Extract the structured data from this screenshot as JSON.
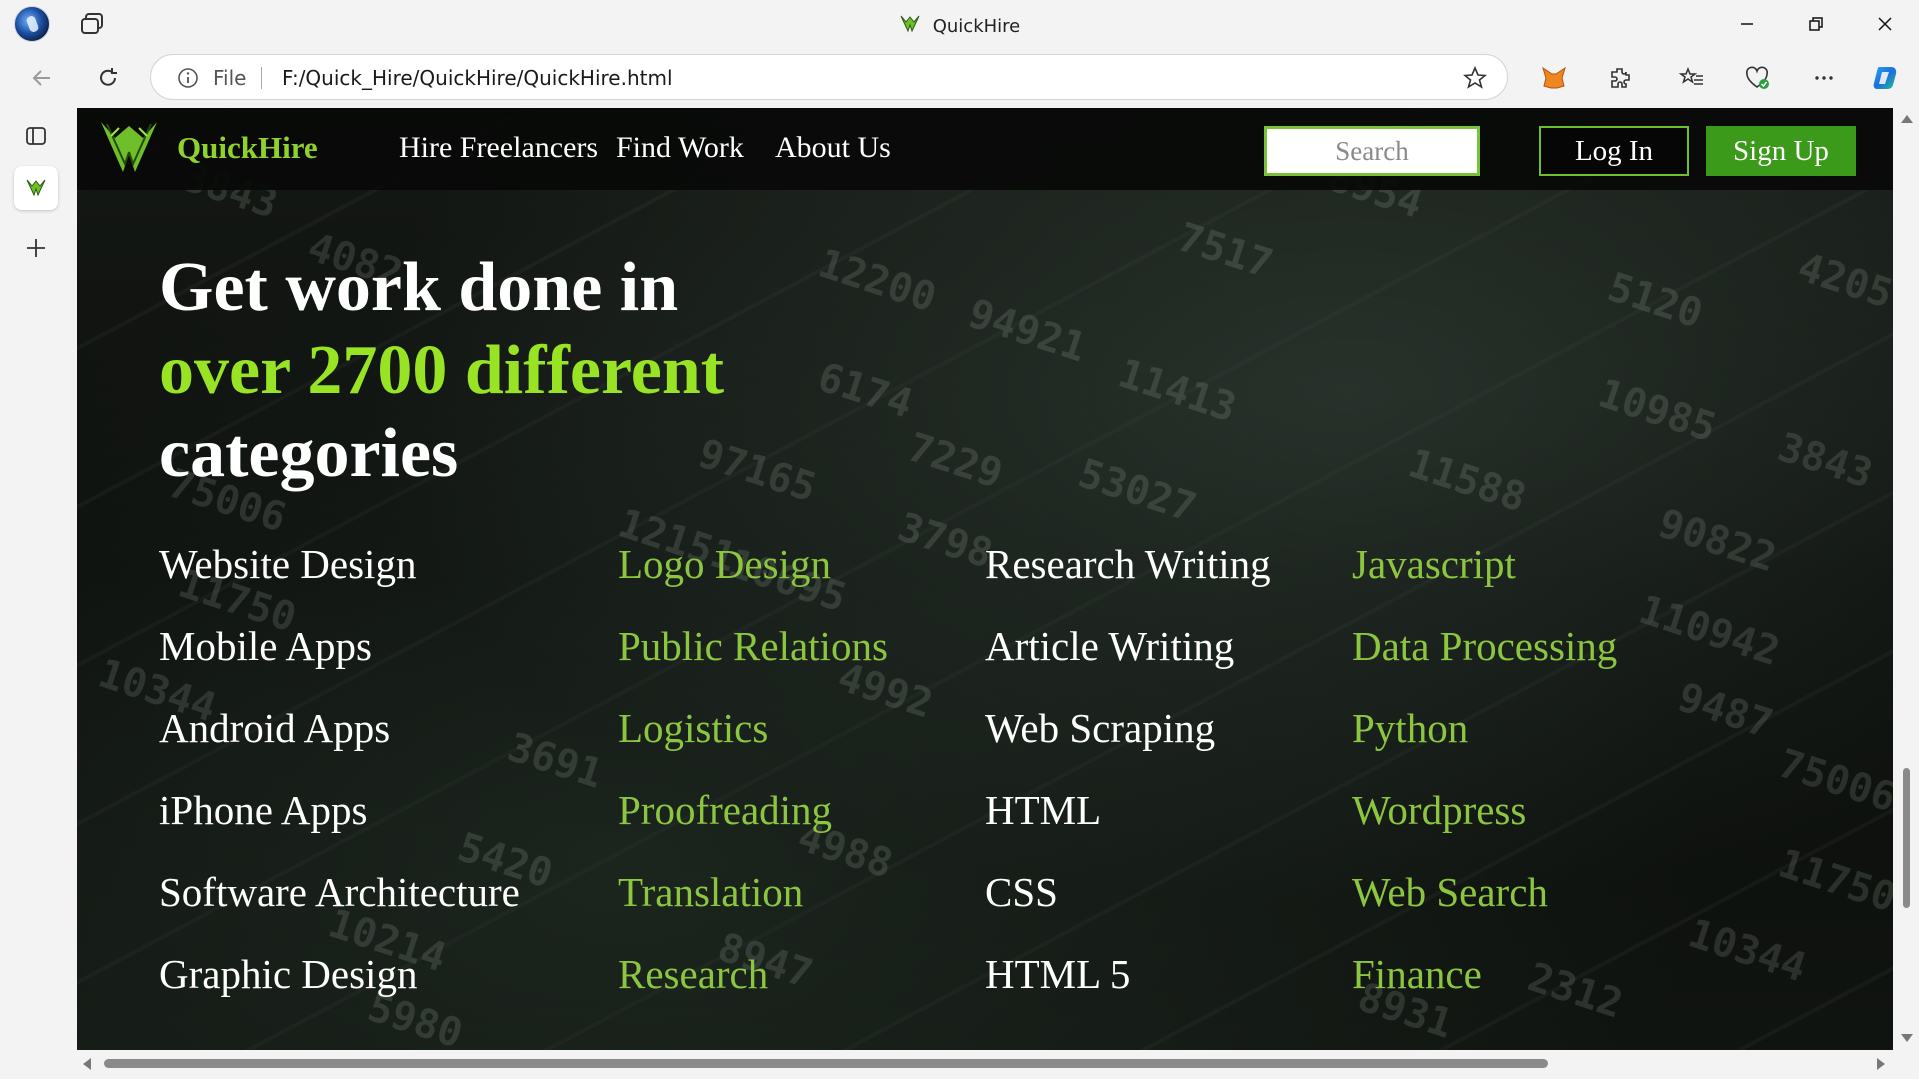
{
  "browser": {
    "window_title": "QuickHire",
    "address_scheme": "File",
    "address_url": "F:/Quick_Hire/QuickHire/QuickHire.html"
  },
  "site": {
    "brand": "QuickHire",
    "nav": [
      "Hire Freelancers",
      "Find Work",
      "About Us"
    ],
    "search_placeholder": "Search",
    "login_label": "Log In",
    "signup_label": "Sign Up",
    "accent_color": "#99e325",
    "signup_color": "#3c9a1a"
  },
  "hero": {
    "line1": "Get work done in",
    "line2": "over 2700 different",
    "line3": "categories"
  },
  "categories": {
    "col1": [
      "Website Design",
      "Mobile Apps",
      "Android Apps",
      "iPhone Apps",
      "Software Architecture",
      "Graphic Design"
    ],
    "col2": [
      "Logo Design",
      "Public Relations",
      "Logistics",
      "Proofreading",
      "Translation",
      "Research"
    ],
    "col3": [
      "Research Writing",
      "Article Writing",
      "Web Scraping",
      "HTML",
      "CSS",
      "HTML 5"
    ],
    "col4": [
      "Javascript",
      "Data Processing",
      "Python",
      "Wordpress",
      "Web Search",
      "Finance"
    ]
  }
}
